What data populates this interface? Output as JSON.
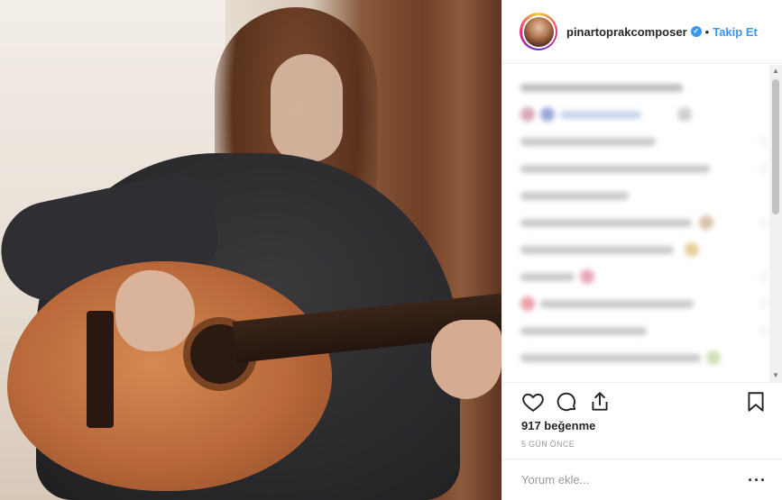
{
  "post": {
    "image_alt": "",
    "username": "pinartoprakcomposer",
    "separator": "•",
    "follow_label": "Takip Et",
    "verified_icon": "check-icon",
    "likes_text": "917 beğenme",
    "time_text": "5 GÜN ÖNCE",
    "comment_placeholder": "Yorum ekle...",
    "more_label": "···"
  },
  "colors": {
    "accent": "#3897f0",
    "text": "#262626",
    "muted": "#999999",
    "border": "#efefef"
  },
  "icons": {
    "like": "heart-outline-icon",
    "comment": "speech-bubble-icon",
    "share": "share-upload-icon",
    "save": "bookmark-icon",
    "scroll_up": "triangle-up-icon",
    "scroll_down": "triangle-down-icon"
  }
}
